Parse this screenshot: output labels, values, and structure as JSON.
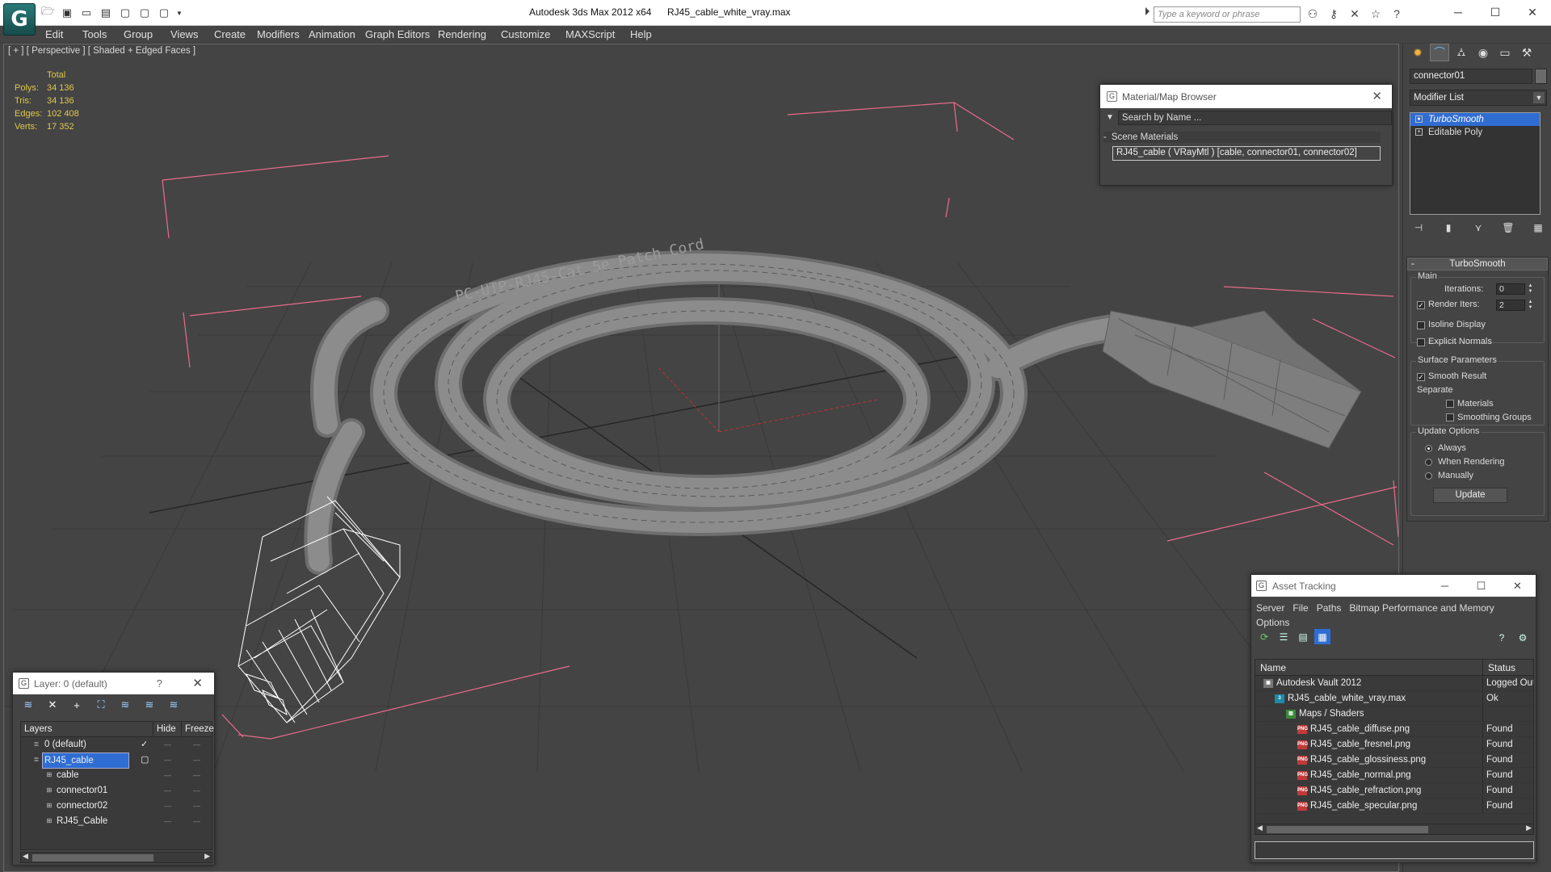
{
  "titlebar": {
    "app_title": "Autodesk 3ds Max  2012 x64",
    "file_name": "RJ45_cable_white_vray.max",
    "search_placeholder": "Type a keyword or phrase",
    "logo_glyph": "G",
    "qat_icons": [
      "open-folder-icon",
      "save-icon",
      "new-scene-icon",
      "hold-icon",
      "fetch-icon",
      "undo-icon",
      "redo-icon",
      "customize-dropdown-icon"
    ],
    "help_icons": [
      "binoculars-icon",
      "key-icon",
      "exchange-icon",
      "star-icon",
      "help-icon"
    ],
    "window_controls": [
      "minimize-icon",
      "maximize-icon",
      "close-icon"
    ]
  },
  "menu": [
    "Edit",
    "Tools",
    "Group",
    "Views",
    "Create",
    "Modifiers",
    "Animation",
    "Graph Editors",
    "Rendering",
    "Customize",
    "MAXScript",
    "Help"
  ],
  "viewport": {
    "label": "[ + ] [ Perspective ] [ Shaded + Edged Faces ]",
    "stats": {
      "header": "Total",
      "rows": [
        {
          "label": "Polys:",
          "value": "34 136"
        },
        {
          "label": "Tris:",
          "value": "34 136"
        },
        {
          "label": "Edges:",
          "value": "102 408"
        },
        {
          "label": "Verts:",
          "value": "17 352"
        }
      ]
    },
    "printed_text": "PC-UTP-RJ45-Cat 5e Patch Cord"
  },
  "material_browser": {
    "title": "Material/Map Browser",
    "search_placeholder": "Search by Name ...",
    "section": "Scene Materials",
    "item": "RJ45_cable  ( VRayMtl )  [cable, connector01, connector02]"
  },
  "command_panel": {
    "tabs": [
      "create-icon",
      "modify-icon",
      "hierarchy-icon",
      "motion-icon",
      "display-icon",
      "utilities-icon"
    ],
    "object_name": "connector01",
    "modifier_list": "Modifier List",
    "stack": [
      "TurboSmooth",
      "Editable Poly"
    ],
    "stack_tools": [
      "pin-stack-icon",
      "show-end-result-icon",
      "make-unique-icon",
      "remove-modifier-icon",
      "configure-sets-icon"
    ],
    "turbosmooth": {
      "title": "TurboSmooth",
      "main_label": "Main",
      "iterations_label": "Iterations:",
      "iterations_value": "0",
      "render_iters_label": "Render Iters:",
      "render_iters_value": "2",
      "isoline_label": "Isoline Display",
      "explicit_label": "Explicit Normals",
      "surface_label": "Surface Parameters",
      "smooth_label": "Smooth Result",
      "separate_label": "Separate",
      "materials_label": "Materials",
      "smoothing_groups_label": "Smoothing Groups",
      "update_options_label": "Update Options",
      "always_label": "Always",
      "when_rendering_label": "When Rendering",
      "manually_label": "Manually",
      "update_button": "Update",
      "render_iters_checked": true,
      "smooth_result_checked": true,
      "update_mode": "Always"
    }
  },
  "asset_tracking": {
    "title": "Asset Tracking",
    "menu": [
      "Server",
      "File",
      "Paths",
      "Bitmap Performance and Memory",
      "Options"
    ],
    "columns": [
      "Name",
      "Status"
    ],
    "rows": [
      {
        "name": "Autodesk Vault 2012",
        "status": "Logged Out",
        "indent": 1,
        "icon": "vault-icon"
      },
      {
        "name": "RJ45_cable_white_vray.max",
        "status": "Ok",
        "indent": 2,
        "icon": "max-file-icon"
      },
      {
        "name": "Maps / Shaders",
        "status": "",
        "indent": 3,
        "icon": "maps-shaders-icon"
      },
      {
        "name": "RJ45_cable_diffuse.png",
        "status": "Found",
        "indent": 4,
        "icon": "png-icon"
      },
      {
        "name": "RJ45_cable_fresnel.png",
        "status": "Found",
        "indent": 4,
        "icon": "png-icon"
      },
      {
        "name": "RJ45_cable_glossiness.png",
        "status": "Found",
        "indent": 4,
        "icon": "png-icon"
      },
      {
        "name": "RJ45_cable_normal.png",
        "status": "Found",
        "indent": 4,
        "icon": "png-icon"
      },
      {
        "name": "RJ45_cable_refraction.png",
        "status": "Found",
        "indent": 4,
        "icon": "png-icon"
      },
      {
        "name": "RJ45_cable_specular.png",
        "status": "Found",
        "indent": 4,
        "icon": "png-icon"
      }
    ]
  },
  "layer_panel": {
    "title": "Layer: 0 (default)",
    "help": "?",
    "columns": [
      "Layers",
      "Hide",
      "Freeze"
    ],
    "rows": [
      {
        "name": "0 (default)",
        "indent": 1,
        "active": true,
        "selected": false,
        "kind": "layer"
      },
      {
        "name": "RJ45_cable",
        "indent": 1,
        "active": false,
        "selected": true,
        "kind": "layer"
      },
      {
        "name": "cable",
        "indent": 2,
        "active": false,
        "selected": false,
        "kind": "object"
      },
      {
        "name": "connector01",
        "indent": 2,
        "active": false,
        "selected": false,
        "kind": "object"
      },
      {
        "name": "connector02",
        "indent": 2,
        "active": false,
        "selected": false,
        "kind": "object"
      },
      {
        "name": "RJ45_Cable",
        "indent": 2,
        "active": false,
        "selected": false,
        "kind": "object"
      }
    ]
  },
  "colors": {
    "selection_blue": "#2f6dd3",
    "stats_yellow": "#e0c84a",
    "viewport_bg": "#444444",
    "bounds_pink": "#e86b8c"
  }
}
